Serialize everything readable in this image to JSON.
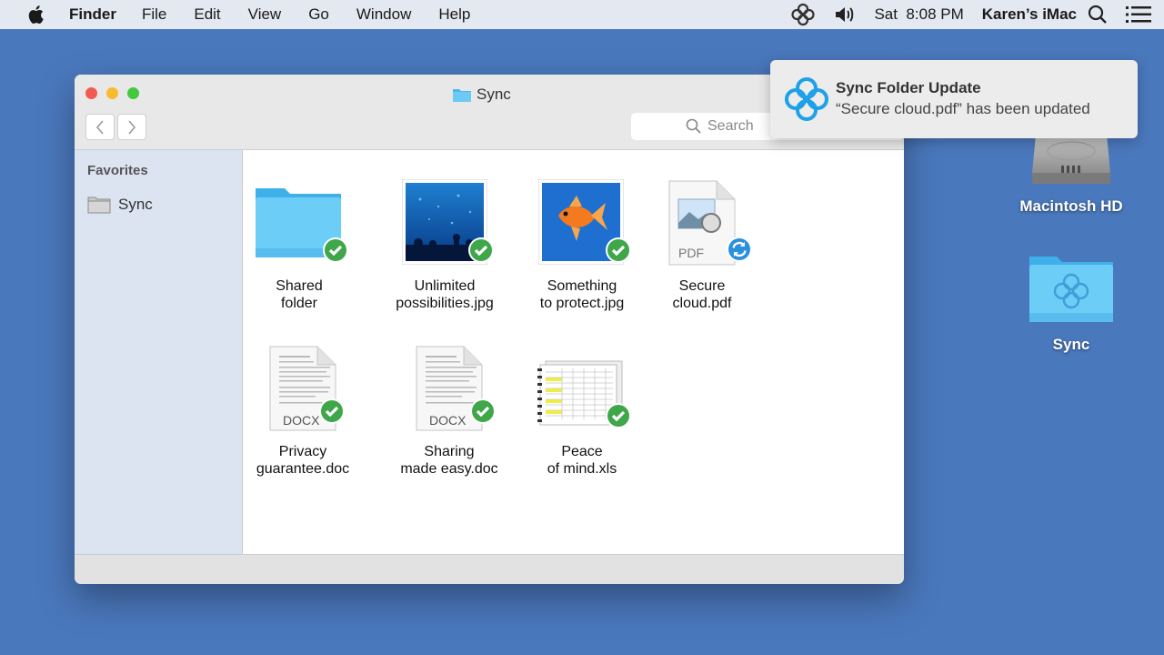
{
  "menubar": {
    "app": "Finder",
    "menus": [
      "File",
      "Edit",
      "View",
      "Go",
      "Window",
      "Help"
    ],
    "clock": "Sat  8:08 PM",
    "computer_name": "Karen’s iMac"
  },
  "window": {
    "title": "Sync",
    "search_placeholder": "Search",
    "sidebar": {
      "heading": "Favorites",
      "items": [
        "Sync"
      ]
    },
    "files": [
      {
        "name": "Shared folder",
        "line1": "Shared",
        "line2": "folder",
        "type": "folder",
        "status": "synced"
      },
      {
        "name": "Unlimited possibilities.jpg",
        "line1": "Unlimited",
        "line2": "possibilities.jpg",
        "type": "image",
        "status": "synced"
      },
      {
        "name": "Something to protect.jpg",
        "line1": "Something",
        "line2": "to protect.jpg",
        "type": "image",
        "status": "synced"
      },
      {
        "name": "Secure cloud.pdf",
        "line1": "Secure",
        "line2": "cloud.pdf",
        "type": "pdf",
        "ext": "PDF",
        "status": "syncing"
      },
      {
        "name": "Privacy guarantee.doc",
        "line1": "Privacy",
        "line2": "guarantee.doc",
        "type": "docx",
        "ext": "DOCX",
        "status": "synced"
      },
      {
        "name": "Sharing made easy.doc",
        "line1": "Sharing",
        "line2": "made easy.doc",
        "type": "docx",
        "ext": "DOCX",
        "status": "synced"
      },
      {
        "name": "Peace of mind.xls",
        "line1": "Peace",
        "line2": "of mind.xls",
        "type": "spreadsheet",
        "status": "synced"
      }
    ]
  },
  "notification": {
    "title": "Sync Folder Update",
    "body": "“Secure cloud.pdf” has been updated"
  },
  "desktop": {
    "items": [
      "Macintosh HD",
      "Sync"
    ]
  },
  "colors": {
    "desktop": "#4a78bd",
    "sync_blue": "#1ea1e8",
    "synced_green": "#3fa64a",
    "syncing_blue": "#2a90e0",
    "folder": "#5dc4f5"
  }
}
